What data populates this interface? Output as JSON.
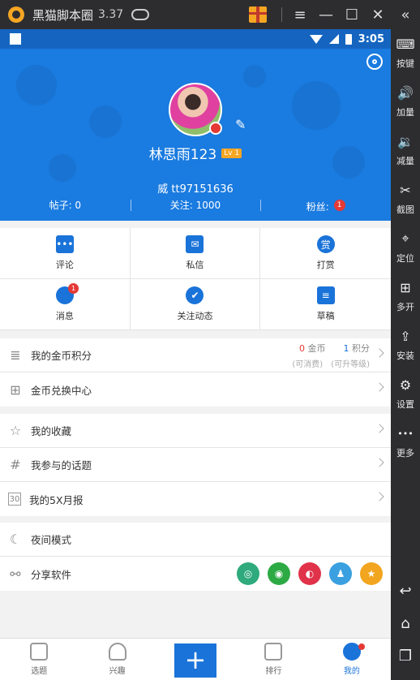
{
  "emulator": {
    "title": "黑猫脚本圈",
    "version": "3.37",
    "window_buttons": [
      "≡",
      "—",
      "☐",
      "✕"
    ],
    "collapse_label": "«"
  },
  "side_toolbar": {
    "items": [
      {
        "icon": "keyboard-icon",
        "label": "按键",
        "glyph": "⌨"
      },
      {
        "icon": "volume-up-icon",
        "label": "加量",
        "glyph": "🔊"
      },
      {
        "icon": "volume-down-icon",
        "label": "减量",
        "glyph": "🔉"
      },
      {
        "icon": "scissors-icon",
        "label": "截图",
        "glyph": "✂"
      },
      {
        "icon": "location-icon",
        "label": "定位",
        "glyph": "⌖"
      },
      {
        "icon": "multi-open-icon",
        "label": "多开",
        "glyph": "⊞"
      },
      {
        "icon": "apk-install-icon",
        "label": "安装",
        "glyph": "⇪"
      },
      {
        "icon": "settings-gear-icon",
        "label": "设置",
        "glyph": "⚙"
      },
      {
        "icon": "more-dots-icon",
        "label": "更多",
        "glyph": "•••"
      }
    ],
    "nav": [
      {
        "icon": "back-icon",
        "glyph": "↩"
      },
      {
        "icon": "home-icon",
        "glyph": "⌂"
      },
      {
        "icon": "recent-apps-icon",
        "glyph": "❐"
      }
    ]
  },
  "status_bar": {
    "time": "3:05"
  },
  "profile": {
    "name": "林思雨123",
    "level": "Lv 1",
    "id_text": "威  tt97151636",
    "stats": {
      "posts": "帖子: 0",
      "following": "关注: 1000",
      "fans": "粉丝:",
      "fans_badge": "1"
    }
  },
  "grid": {
    "items": [
      {
        "label": "评论",
        "icon": "comment-icon",
        "glyph": "•••"
      },
      {
        "label": "私信",
        "icon": "mail-icon",
        "glyph": "✉"
      },
      {
        "label": "打赏",
        "icon": "reward-icon",
        "glyph": "赏"
      },
      {
        "label": "消息",
        "icon": "bell-icon",
        "glyph": "🔔",
        "badge": "1"
      },
      {
        "label": "关注动态",
        "icon": "follow-feed-icon",
        "glyph": "✔"
      },
      {
        "label": "草稿",
        "icon": "draft-icon",
        "glyph": "≡"
      }
    ]
  },
  "coins_row": {
    "label": "我的金币积分",
    "coin_value": "0",
    "coin_unit": "金币",
    "coin_note": "(可消费)",
    "points_value": "1",
    "points_unit": "积分",
    "points_note": "(可升等级)"
  },
  "exchange_row": {
    "label": "金币兑换中心"
  },
  "list_rows": [
    {
      "label": "我的收藏",
      "icon": "star-outline-icon",
      "glyph": "☆"
    },
    {
      "label": "我参与的话题",
      "icon": "hashtag-icon",
      "glyph": "#"
    },
    {
      "label": "我的5X月报",
      "icon": "calendar-icon",
      "glyph": "30"
    }
  ],
  "night_row": {
    "label": "夜间模式"
  },
  "share_row": {
    "label": "分享软件",
    "targets": [
      {
        "icon": "moments-icon",
        "glyph": "◎",
        "color": "#2eaa7c"
      },
      {
        "icon": "wechat-icon",
        "glyph": "◉",
        "color": "#2eaa44"
      },
      {
        "icon": "weibo-icon",
        "glyph": "◐",
        "color": "#e0334a"
      },
      {
        "icon": "qq-icon",
        "glyph": "♟",
        "color": "#3aa0e0"
      },
      {
        "icon": "qzone-icon",
        "glyph": "★",
        "color": "#f2a51e"
      }
    ]
  },
  "bottom_nav": [
    {
      "label": "选题",
      "icon": "topics-icon"
    },
    {
      "label": "兴趣",
      "icon": "heart-icon"
    },
    {
      "label": "",
      "icon": "plus-icon",
      "glyph": "+"
    },
    {
      "label": "排行",
      "icon": "ranking-icon"
    },
    {
      "label": "我的",
      "icon": "profile-icon"
    }
  ],
  "colors": {
    "primary": "#1a7be0",
    "accent_red": "#e53935"
  }
}
